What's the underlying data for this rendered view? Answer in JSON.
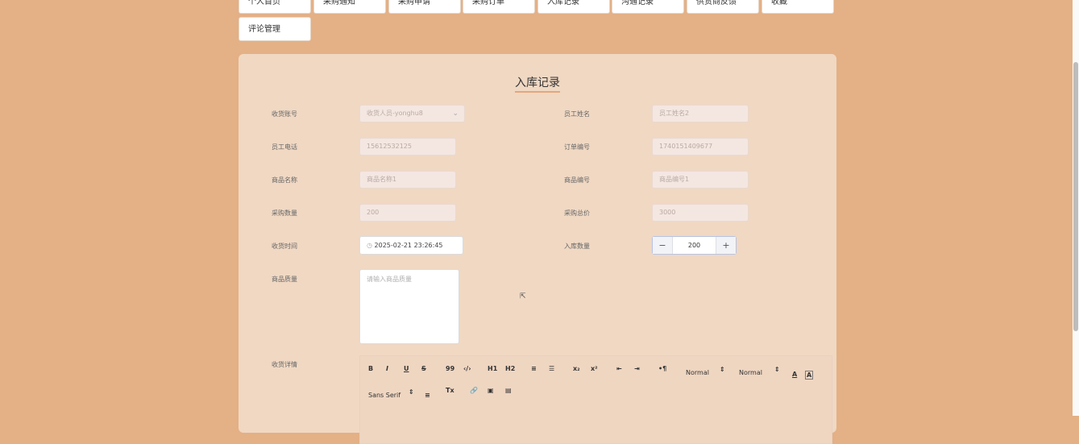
{
  "tabs": [
    "个人首页",
    "采购通知",
    "采购申请",
    "采购订单",
    "入库记录",
    "沟通记录",
    "供货商反馈",
    "收藏",
    "评论管理"
  ],
  "form": {
    "title": "入库记录",
    "receiver_account": {
      "label": "收货账号",
      "placeholder": "收货人员-yonghu8"
    },
    "employee_name": {
      "label": "员工姓名",
      "placeholder": "员工姓名2"
    },
    "employee_phone": {
      "label": "员工电话",
      "value": "15612532125"
    },
    "order_no": {
      "label": "订单编号",
      "value": "1740151409677"
    },
    "product_name": {
      "label": "商品名称",
      "value": "商品名称1"
    },
    "product_no": {
      "label": "商品编号",
      "value": "商品编号1"
    },
    "purchase_qty": {
      "label": "采购数量",
      "value": "200"
    },
    "purchase_total": {
      "label": "采购总价",
      "value": "3000"
    },
    "receive_time": {
      "label": "收货时间",
      "value": "2025-02-21 23:26:45"
    },
    "stock_qty": {
      "label": "入库数量",
      "value": "200",
      "minus": "−",
      "plus": "+"
    },
    "quality": {
      "label": "商品质量",
      "placeholder": "请输入商品质量"
    },
    "details": {
      "label": "收货详情"
    }
  },
  "editor": {
    "row1": [
      "B",
      "I",
      "U",
      "S",
      "99",
      "‹/›",
      "H1",
      "H2",
      "≡",
      "☰",
      "x₂",
      "x²",
      "⇤",
      "⇥",
      "•¶",
      "Normal",
      "⇕",
      "Normal",
      "⇕",
      "A",
      "A"
    ],
    "row2": [
      "Sans Serif",
      "⇕",
      "≡",
      "Tx",
      "🔗",
      "▣",
      "▤"
    ]
  },
  "icons": {
    "clock": "clock-icon",
    "chevron": "chevron-down-icon"
  }
}
